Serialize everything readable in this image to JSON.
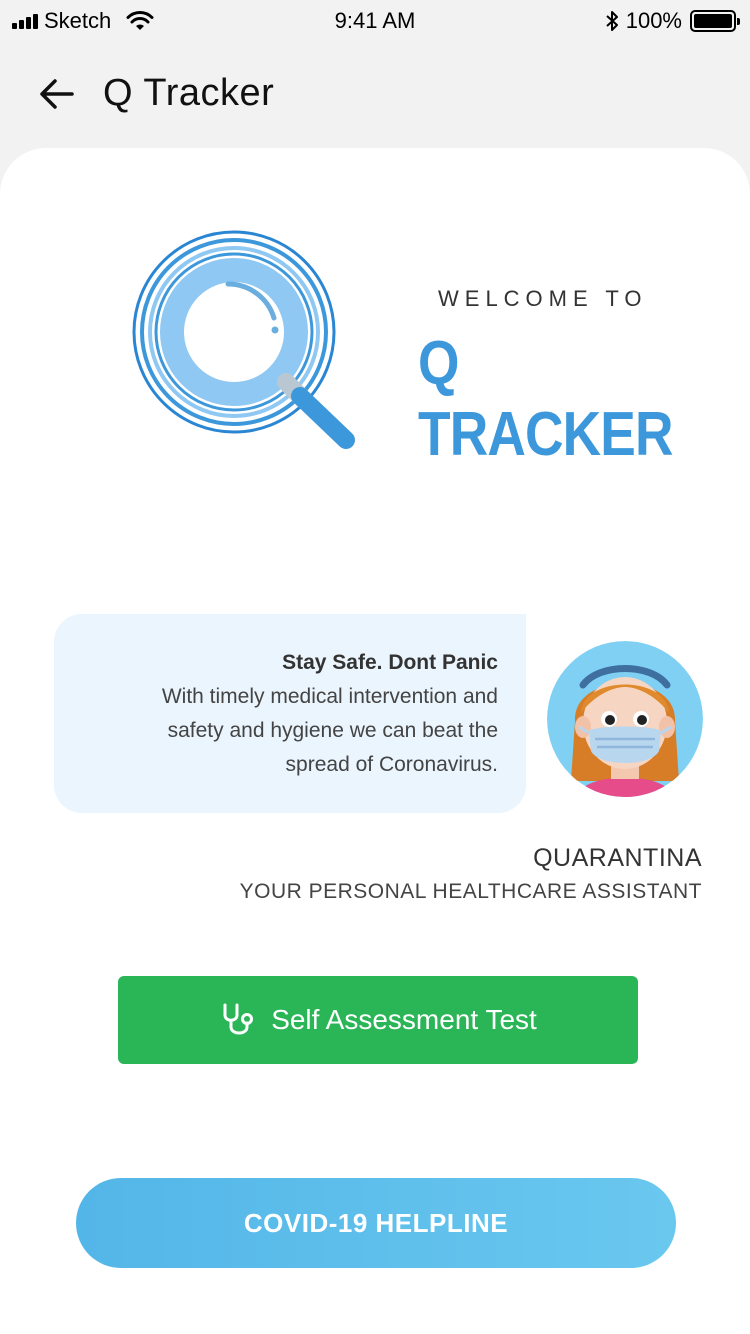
{
  "status_bar": {
    "carrier": "Sketch",
    "time": "9:41 AM",
    "battery": "100%"
  },
  "header": {
    "title": "Q Tracker",
    "back_icon": "arrow-left-icon"
  },
  "hero": {
    "welcome": "WELCOME TO",
    "brand": "Q TRACKER",
    "logo_icon": "magnifier-icon"
  },
  "message": {
    "title": "Stay Safe. Dont Panic",
    "lines": [
      "With timely medical intervention and",
      "safety and hygiene we can beat the",
      "spread of Coronavirus."
    ]
  },
  "assistant": {
    "name": "QUARANTINA",
    "role": "YOUR PERSONAL HEALTHCARE ASSISTANT",
    "avatar_icon": "masked-girl-avatar"
  },
  "actions": {
    "self_test_label": "Self Assessment Test",
    "self_test_icon": "stethoscope-icon",
    "helpline_label": "COVID-19 HELPLINE"
  },
  "colors": {
    "brand_blue": "#3d98db",
    "green": "#2ab556",
    "helpline_blue": "#5cbfec",
    "bubble_bg": "#ebf5fd"
  }
}
